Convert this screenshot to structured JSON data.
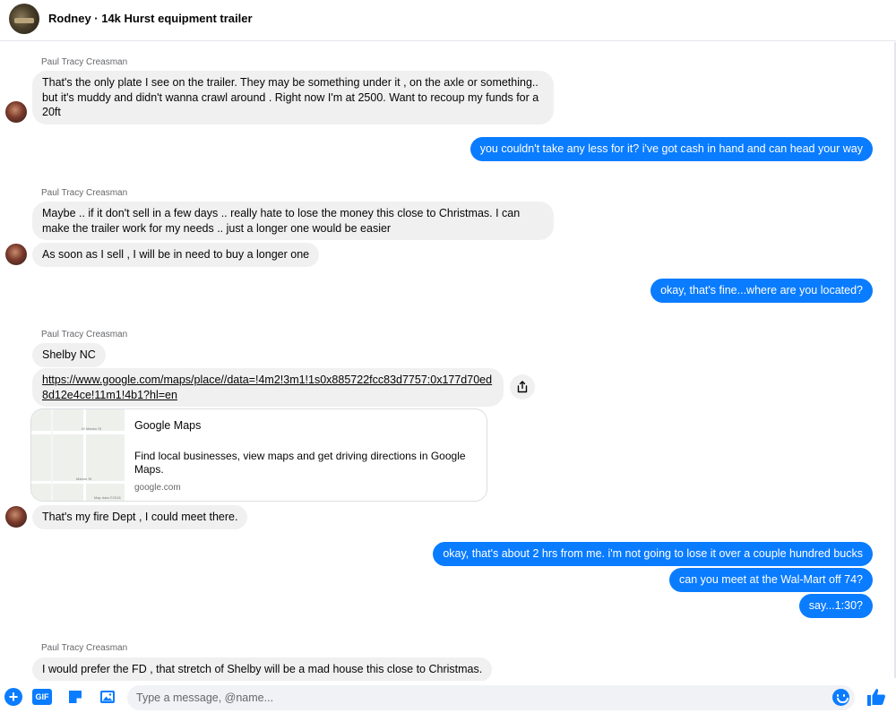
{
  "header": {
    "title": "Rodney · 14k Hurst equipment trailer"
  },
  "messages": {
    "s1": "Paul Tracy Creasman",
    "m1": "That's the only plate I see on the trailer. They may be something under it , on the axle or something.. but it's muddy and didn't wanna crawl around . Right now I'm at 2500. Want to recoup my funds for a 20ft",
    "o1": "you couldn't take any less for it?  i've got cash in hand and can head your way",
    "s2": "Paul Tracy Creasman",
    "m2": "Maybe .. if it don't sell in a few days .. really hate to lose the money this close to Christmas. I can make the trailer work for my needs .. just a longer one would be easier",
    "m3": "As soon as I sell , I will be in need to buy a longer one",
    "o2": "okay, that's fine...where are you located?",
    "s3": "Paul Tracy Creasman",
    "m4": "Shelby NC",
    "m5": "https://www.google.com/maps/place//data=!4m2!3m1!1s0x885722fcc83d7757:0x177d70ed8d12e4ce!11m1!4b1?hl=en",
    "card": {
      "title": "Google Maps",
      "description": "Find local businesses, view maps and get driving directions in Google Maps.",
      "domain": "google.com",
      "map_label_1": "W Marion St",
      "map_label_2": "Marion St",
      "map_credit": "Map data ©2018"
    },
    "m6": "That's my fire Dept , I could meet there.",
    "o3": "okay, that's about 2 hrs from me.  i'm not going to lose it over a couple hundred bucks",
    "o4": "can you meet at the Wal-Mart off 74?",
    "o5": "say...1:30?",
    "s4": "Paul Tracy Creasman",
    "m7": "I would prefer the FD , that stretch of Shelby will be a mad house this close to Christmas."
  },
  "composer": {
    "placeholder": "Type a message, @name..."
  },
  "colors": {
    "accent": "#0a7cff",
    "incoming_bubble": "#f0f0f0"
  },
  "icons": [
    "plus-icon",
    "gif-icon",
    "sticker-icon",
    "image-icon",
    "share-icon",
    "emoji-icon",
    "thumbs-up-icon"
  ]
}
